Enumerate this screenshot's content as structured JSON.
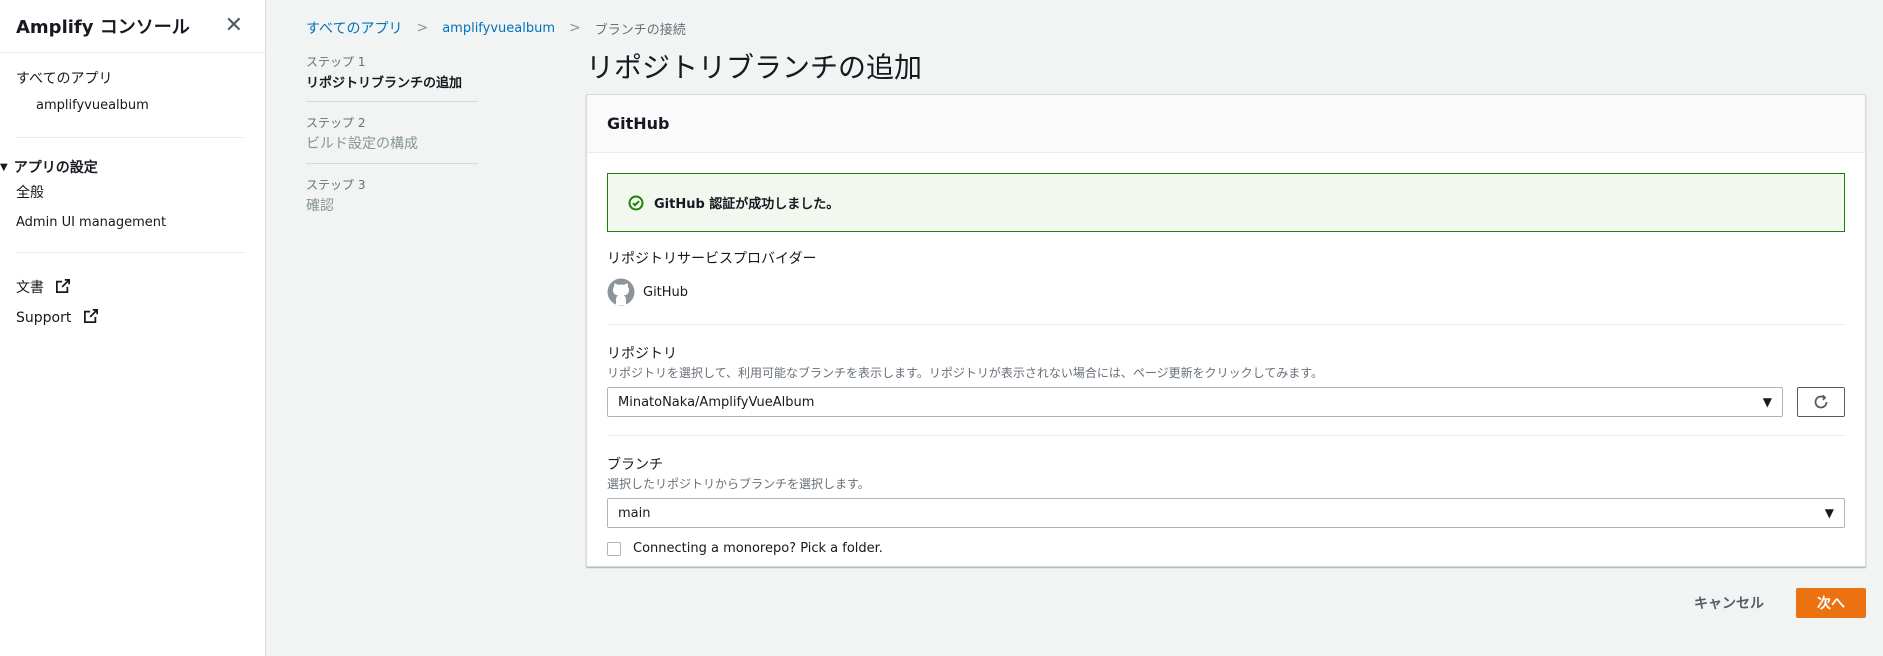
{
  "sidebar": {
    "title": "Amplify コンソール",
    "all_apps": "すべてのアプリ",
    "app_name": "amplifyvuealbum",
    "settings_group": "アプリの設定",
    "general": "全般",
    "admin_ui": "Admin UI management",
    "docs": "文書",
    "support": "Support"
  },
  "breadcrumb": {
    "all_apps": "すべてのアプリ",
    "app_name": "amplifyvuealbum",
    "current": "ブランチの接続"
  },
  "steps": [
    {
      "num": "ステップ 1",
      "label": "リポジトリブランチの追加"
    },
    {
      "num": "ステップ 2",
      "label": "ビルド設定の構成"
    },
    {
      "num": "ステップ 3",
      "label": "確認"
    }
  ],
  "page_title": "リポジトリブランチの追加",
  "panel": {
    "header": "GitHub",
    "alert": "GitHub 認証が成功しました。",
    "provider_label": "リポジトリサービスプロバイダー",
    "provider_name": "GitHub",
    "repo_label": "リポジトリ",
    "repo_desc": "リポジトリを選択して、利用可能なブランチを表示します。リポジトリが表示されない場合には、ページ更新をクリックしてみます。",
    "repo_value": "MinatoNaka/AmplifyVueAlbum",
    "branch_label": "ブランチ",
    "branch_desc": "選択したリポジトリからブランチを選択します。",
    "branch_value": "main",
    "monorepo_label": "Connecting a monorepo? Pick a folder."
  },
  "footer": {
    "cancel": "キャンセル",
    "next": "次へ"
  },
  "colors": {
    "accent": "#ec7211",
    "link": "#0073bb",
    "success": "#1d8102"
  }
}
